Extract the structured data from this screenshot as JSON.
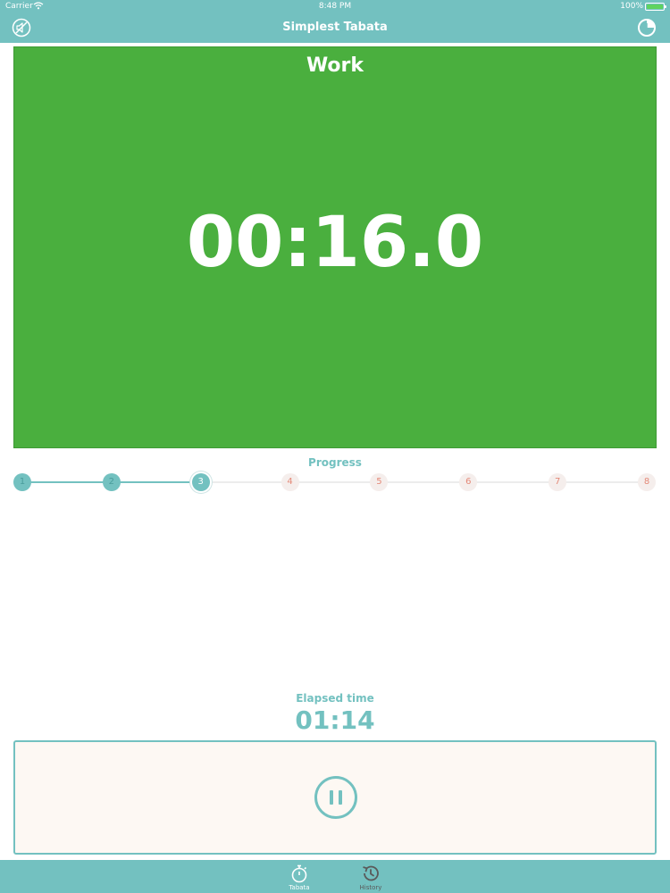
{
  "status_bar": {
    "carrier": "Carrier",
    "time": "8:48 PM",
    "battery": "100%"
  },
  "nav": {
    "title": "Simplest Tabata",
    "left_icon": "mute-icon",
    "right_icon": "clock-pie-icon"
  },
  "workout": {
    "phase": "Work",
    "timer": "00:16.0",
    "phase_color": "#4aaf3e"
  },
  "progress": {
    "label": "Progress",
    "current_round": 3,
    "rounds": [
      "1",
      "2",
      "3",
      "4",
      "5",
      "6",
      "7",
      "8"
    ]
  },
  "elapsed": {
    "label": "Elapsed time",
    "value": "01:14"
  },
  "controls": {
    "pause_icon": "pause-icon"
  },
  "tabbar": {
    "tabs": [
      {
        "label": "Tabata",
        "icon": "stopwatch-icon",
        "active": true
      },
      {
        "label": "History",
        "icon": "history-icon",
        "active": false
      }
    ]
  },
  "colors": {
    "accent": "#73c1c0",
    "work": "#4aaf3e",
    "panel_background": "#fdf8f3",
    "upcoming_round": "#e48a79"
  }
}
